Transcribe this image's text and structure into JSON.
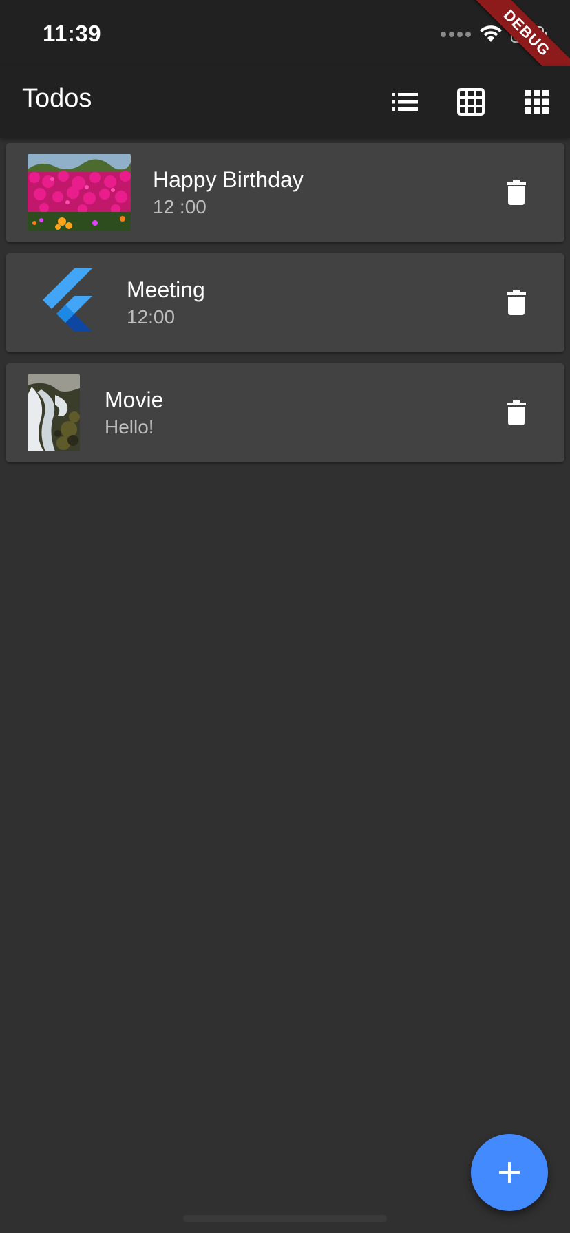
{
  "status_bar": {
    "time": "11:39"
  },
  "debug_banner": {
    "label": "DEBUG"
  },
  "app_bar": {
    "title": "Todos",
    "actions": [
      {
        "icon": "list-view-icon"
      },
      {
        "icon": "grid-view-icon"
      },
      {
        "icon": "apps-grid-icon"
      }
    ]
  },
  "todos": [
    {
      "title": "Happy Birthday",
      "subtitle": "12 :00",
      "thumbnail": "flowers-photo"
    },
    {
      "title": "Meeting",
      "subtitle": "12:00",
      "thumbnail": "flutter-logo"
    },
    {
      "title": "Movie",
      "subtitle": "Hello!",
      "thumbnail": "waterfall-photo"
    }
  ],
  "colors": {
    "background": "#303030",
    "app_bar": "#212121",
    "card": "#424242",
    "fab": "#448aff",
    "debug": "#8e1b1b"
  }
}
